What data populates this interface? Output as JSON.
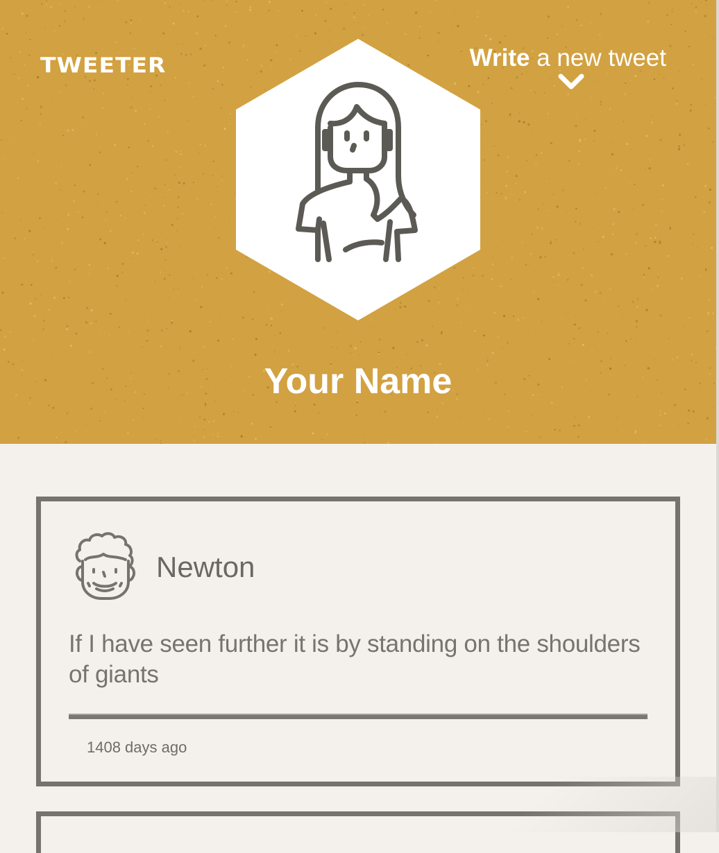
{
  "header": {
    "brand": "TWEETER",
    "compose_strong": "Write",
    "compose_rest": " a new tweet",
    "profile_name": "Your Name",
    "colors": {
      "background": "#d2a141",
      "text": "#ffffff",
      "avatar_bg": "#ffffff",
      "avatar_line": "#5c5a55"
    },
    "icons": {
      "compose_arrow": "chevron-down-icon",
      "avatar": "user-female-icon"
    }
  },
  "tweets": [
    {
      "author": "Newton",
      "avatar_icon": "user-male-curly-icon",
      "content": "If I have seen further it is by standing on the shoulders of giants",
      "time": "1408 days ago"
    }
  ],
  "theme": {
    "page_bg": "#f4f1ed",
    "card_border": "#76736e",
    "text_muted": "#77746f"
  }
}
